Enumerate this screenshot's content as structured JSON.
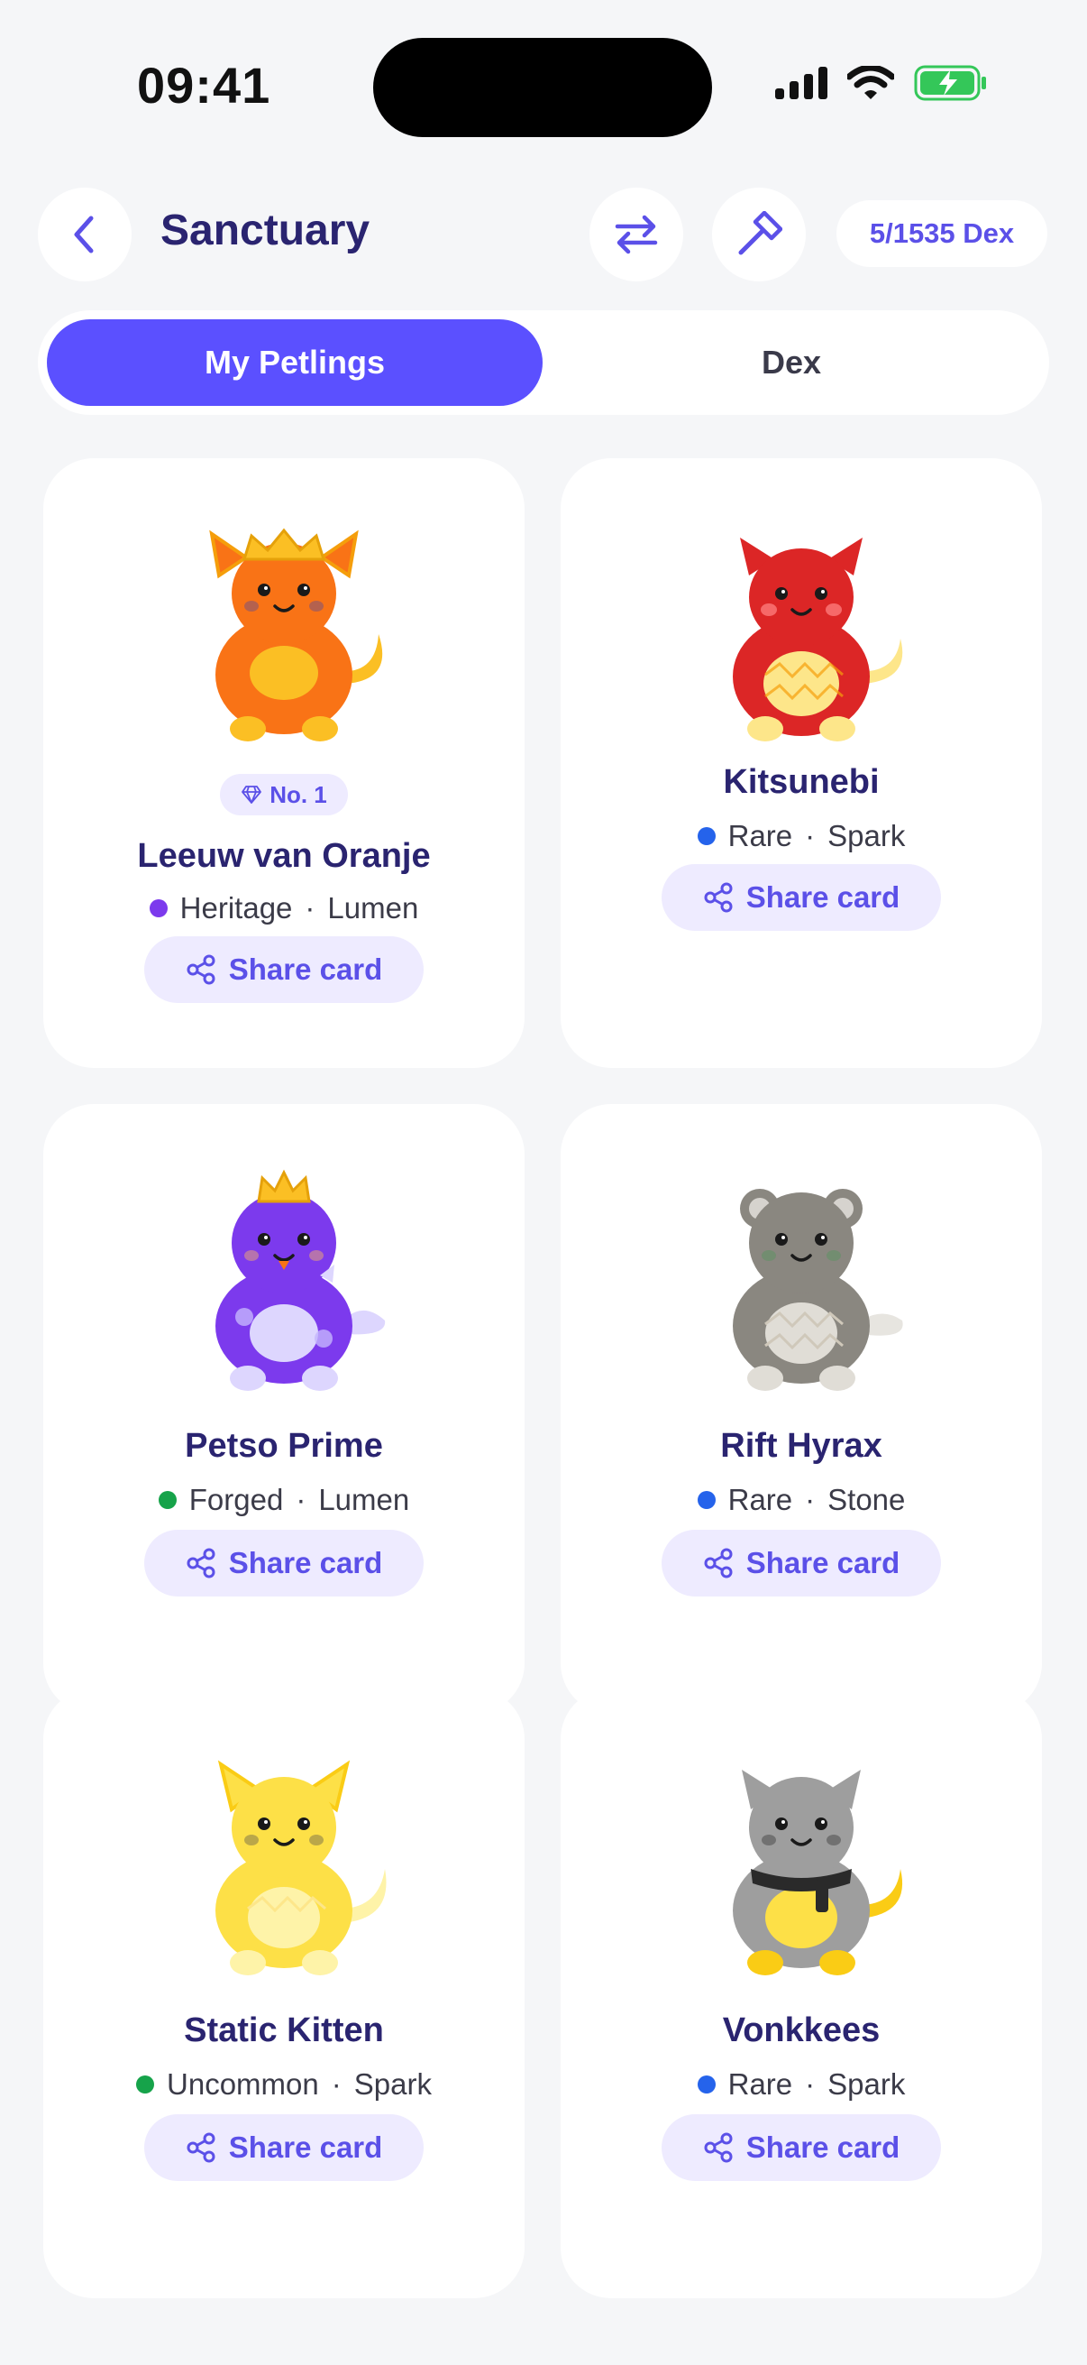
{
  "status_bar": {
    "time": "09:41"
  },
  "header": {
    "title": "Sanctuary",
    "dex_count": "5/1535 Dex"
  },
  "tabs": [
    {
      "label": "My Petlings",
      "active": true
    },
    {
      "label": "Dex",
      "active": false
    }
  ],
  "share_label": "Share card",
  "accent_color": "#5B50FF",
  "cards": [
    {
      "name": "Leeuw van Oranje",
      "badge": "No. 1",
      "rarity": "Heritage",
      "element": "Lumen",
      "dot_color": "#7C3AED",
      "body_color": "#F97316"
    },
    {
      "name": "Kitsunebi",
      "rarity": "Rare",
      "element": "Spark",
      "dot_color": "#2563EB",
      "body_color": "#DC2626"
    },
    {
      "name": "Petso Prime",
      "rarity": "Forged",
      "element": "Lumen",
      "dot_color": "#16A34A",
      "body_color": "#7C3AED"
    },
    {
      "name": "Rift Hyrax",
      "rarity": "Rare",
      "element": "Stone",
      "dot_color": "#2563EB",
      "body_color": "#8A8780"
    },
    {
      "name": "Static Kitten",
      "rarity": "Uncommon",
      "element": "Spark",
      "dot_color": "#16A34A",
      "body_color": "#FCE047"
    },
    {
      "name": "Vonkkees",
      "rarity": "Rare",
      "element": "Spark",
      "dot_color": "#2563EB",
      "body_color": "#9E9E9E"
    }
  ]
}
